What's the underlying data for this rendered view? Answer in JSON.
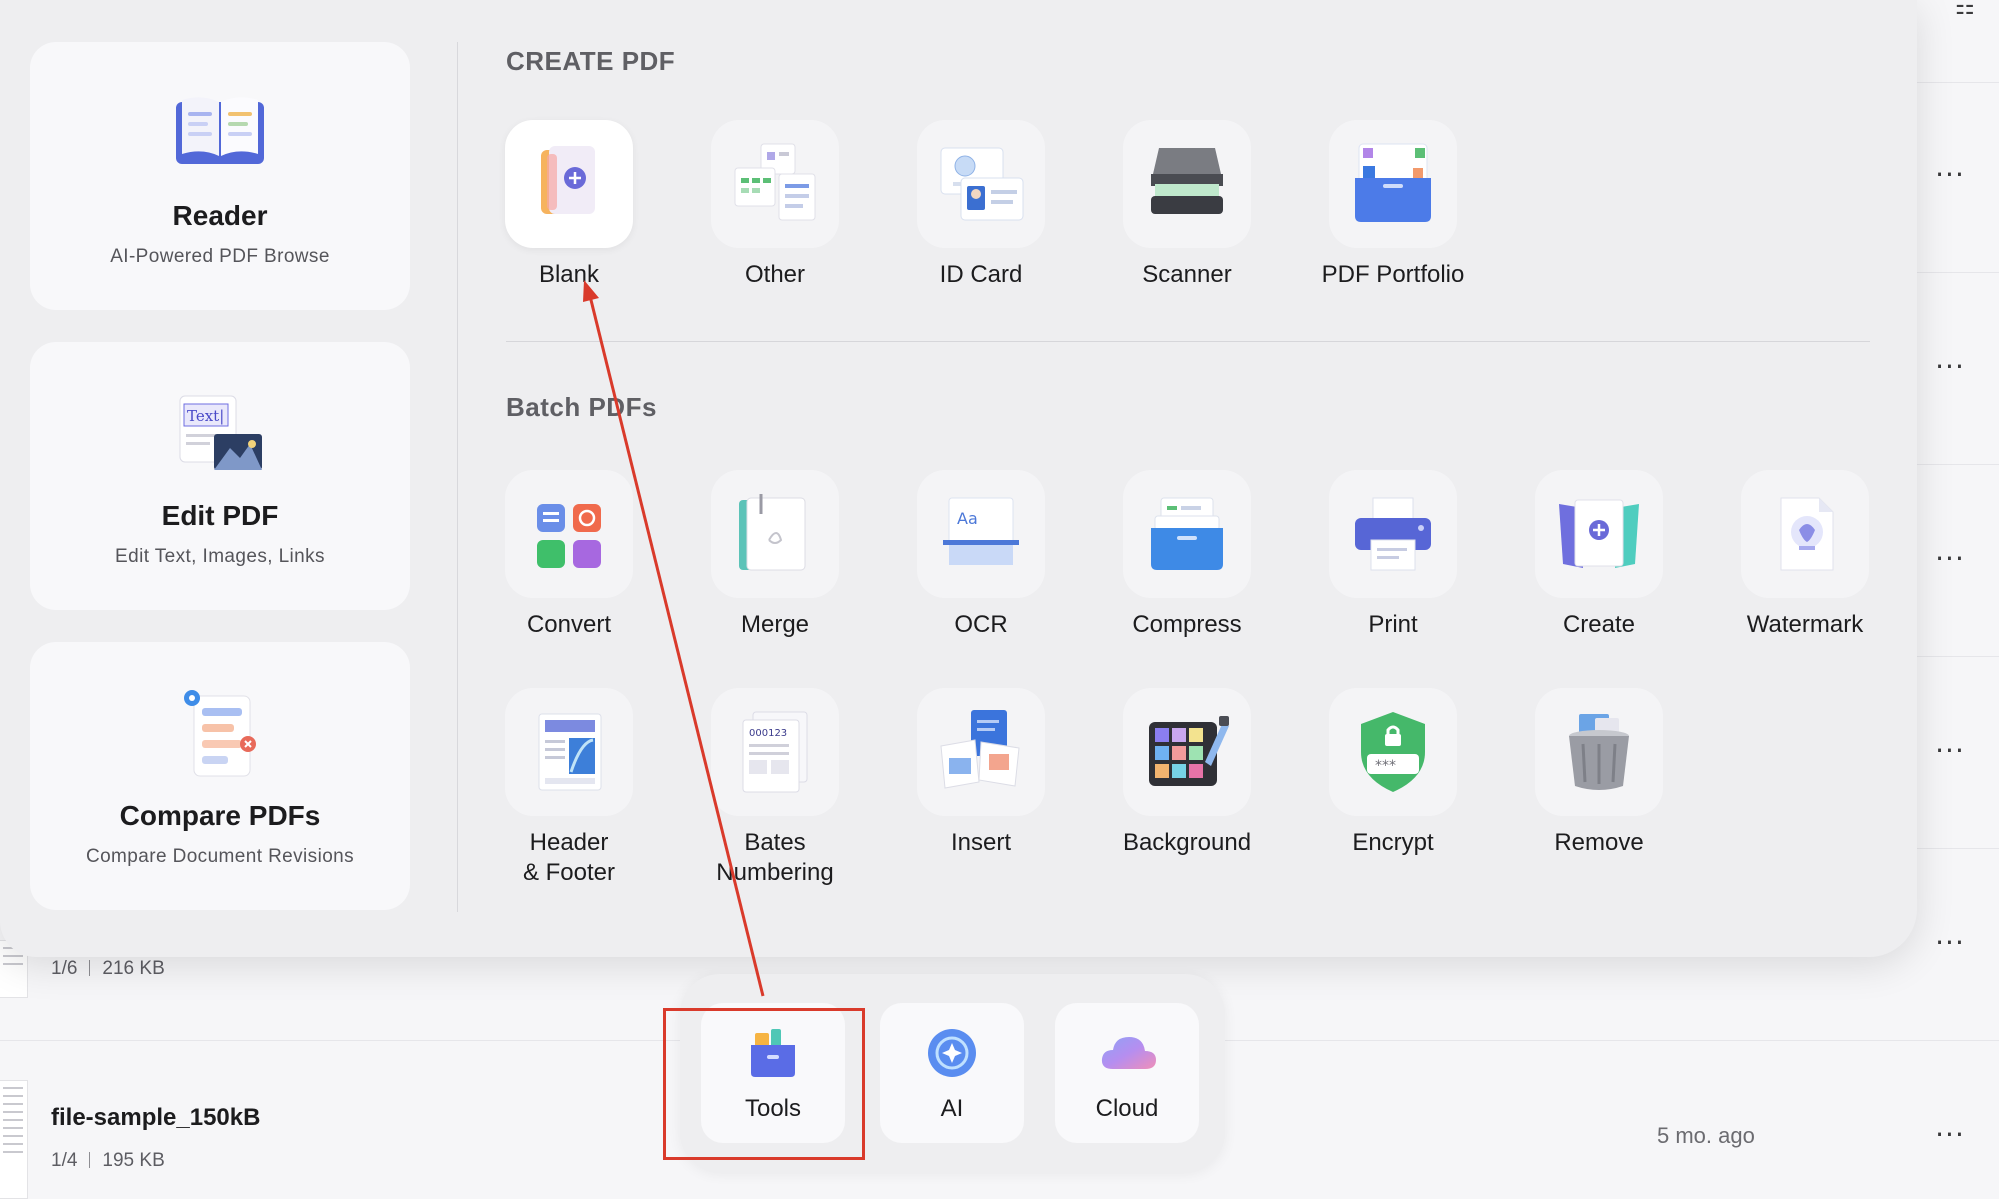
{
  "files": [
    {
      "meta_pages": "1/6",
      "meta_size": "216 KB"
    },
    {
      "name": "file-sample_150kB",
      "meta_pages": "1/4",
      "meta_size": "195 KB",
      "time": "5 mo. ago"
    }
  ],
  "more_label": "···",
  "modes": [
    {
      "title": "Reader",
      "subtitle": "AI-Powered PDF Browse",
      "icon": "reader-book-icon"
    },
    {
      "title": "Edit PDF",
      "subtitle": "Edit Text, Images, Links",
      "icon": "edit-pdf-icon",
      "icon_text": "Text|"
    },
    {
      "title": "Compare PDFs",
      "subtitle": "Compare Document Revisions",
      "icon": "compare-docs-icon"
    }
  ],
  "create_section": {
    "title": "CREATE PDF",
    "tools": [
      {
        "label": "Blank",
        "icon": "blank-page-icon"
      },
      {
        "label": "Other",
        "icon": "other-files-icon"
      },
      {
        "label": "ID Card",
        "icon": "id-card-icon"
      },
      {
        "label": "Scanner",
        "icon": "scanner-icon"
      },
      {
        "label": "PDF Portfolio",
        "icon": "portfolio-icon"
      }
    ]
  },
  "batch_section": {
    "title": "Batch PDFs",
    "tools": [
      {
        "label": "Convert",
        "icon": "convert-icon"
      },
      {
        "label": "Merge",
        "icon": "merge-icon"
      },
      {
        "label": "OCR",
        "icon": "ocr-icon",
        "icon_text": "Aa"
      },
      {
        "label": "Compress",
        "icon": "compress-icon"
      },
      {
        "label": "Print",
        "icon": "print-icon"
      },
      {
        "label": "Create",
        "icon": "create-icon"
      },
      {
        "label": "Watermark",
        "icon": "watermark-icon"
      },
      {
        "label_line1": "Header",
        "label_line2": "& Footer",
        "icon": "header-footer-icon"
      },
      {
        "label_line1": "Bates",
        "label_line2": "Numbering",
        "icon": "bates-numbering-icon",
        "icon_text": "000123"
      },
      {
        "label": "Insert",
        "icon": "insert-icon"
      },
      {
        "label": "Background",
        "icon": "background-icon"
      },
      {
        "label": "Encrypt",
        "icon": "encrypt-icon",
        "icon_text": "***"
      },
      {
        "label": "Remove",
        "icon": "trash-icon"
      }
    ]
  },
  "dock": [
    {
      "label": "Tools",
      "icon": "tools-toolbox-icon",
      "selected": true
    },
    {
      "label": "AI",
      "icon": "ai-sparkle-icon"
    },
    {
      "label": "Cloud",
      "icon": "cloud-icon"
    }
  ],
  "colors": {
    "annotation_red": "#d93a2b",
    "accent_blue": "#5b6ee8"
  }
}
